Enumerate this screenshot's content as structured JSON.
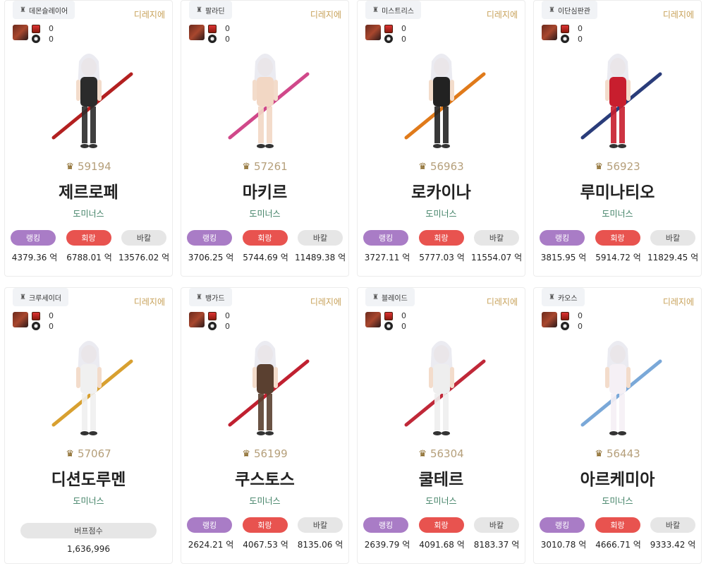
{
  "cards": [
    {
      "job": "데몬슬레이어",
      "server": "디레지에",
      "v1": "0",
      "v2": "0",
      "fame": "59194",
      "name": "제르로페",
      "guild": "도미너스",
      "mode": "stats",
      "rank_label": "랭킹",
      "evade_label": "회랑",
      "ignore_label": "바칼",
      "rank": "4379.36 억",
      "evade": "6788.01 억",
      "ignore": "13576.02 억",
      "body_color": "#2b2b2b",
      "accent": "#b32020"
    },
    {
      "job": "팔라딘",
      "server": "디레지에",
      "v1": "0",
      "v2": "0",
      "fame": "57261",
      "name": "마키르",
      "guild": "도미너스",
      "mode": "stats",
      "rank_label": "랭킹",
      "evade_label": "회랑",
      "ignore_label": "바칼",
      "rank": "3706.25 억",
      "evade": "5744.69 억",
      "ignore": "11489.38 억",
      "body_color": "#f2d7c4",
      "accent": "#d0488a"
    },
    {
      "job": "미스트리스",
      "server": "디레지에",
      "v1": "0",
      "v2": "0",
      "fame": "56963",
      "name": "로카이나",
      "guild": "도미너스",
      "mode": "stats",
      "rank_label": "랭킹",
      "evade_label": "회랑",
      "ignore_label": "바칼",
      "rank": "3727.11 억",
      "evade": "5777.03 억",
      "ignore": "11554.07 억",
      "body_color": "#222222",
      "accent": "#e07a1a"
    },
    {
      "job": "이단심판관",
      "server": "디레지에",
      "v1": "0",
      "v2": "0",
      "fame": "56923",
      "name": "루미나티오",
      "guild": "도미너스",
      "mode": "stats",
      "rank_label": "랭킹",
      "evade_label": "회랑",
      "ignore_label": "바칼",
      "rank": "3815.95 억",
      "evade": "5914.72 억",
      "ignore": "11829.45 억",
      "body_color": "#c81e2e",
      "accent": "#2a3c7a"
    },
    {
      "job": "크루세이더",
      "server": "디레지에",
      "v1": "0",
      "v2": "0",
      "fame": "57067",
      "name": "디션도루멘",
      "guild": "도미너스",
      "mode": "buff",
      "buff_label": "버프점수",
      "buff": "1,636,996",
      "body_color": "#f0f0f0",
      "accent": "#d8a030"
    },
    {
      "job": "뱅가드",
      "server": "디레지에",
      "v1": "0",
      "v2": "0",
      "fame": "56199",
      "name": "쿠스토스",
      "guild": "도미너스",
      "mode": "stats",
      "rank_label": "랭킹",
      "evade_label": "회랑",
      "ignore_label": "바칼",
      "rank": "2624.21 억",
      "evade": "4067.53 억",
      "ignore": "8135.06 억",
      "body_color": "#5a4030",
      "accent": "#c02030"
    },
    {
      "job": "블레이드",
      "server": "디레지에",
      "v1": "0",
      "v2": "0",
      "fame": "56304",
      "name": "쿨테르",
      "guild": "도미너스",
      "mode": "stats",
      "rank_label": "랭킹",
      "evade_label": "회랑",
      "ignore_label": "바칼",
      "rank": "2639.79 억",
      "evade": "4091.68 억",
      "ignore": "8183.37 억",
      "body_color": "#eeeeee",
      "accent": "#c02838"
    },
    {
      "job": "카오스",
      "server": "디레지에",
      "v1": "0",
      "v2": "0",
      "fame": "56443",
      "name": "아르케미아",
      "guild": "도미너스",
      "mode": "stats",
      "rank_label": "랭킹",
      "evade_label": "회랑",
      "ignore_label": "바칼",
      "rank": "3010.78 억",
      "evade": "4666.71 억",
      "ignore": "9333.42 억",
      "body_color": "#f5f0f5",
      "accent": "#7aa8d8"
    }
  ]
}
